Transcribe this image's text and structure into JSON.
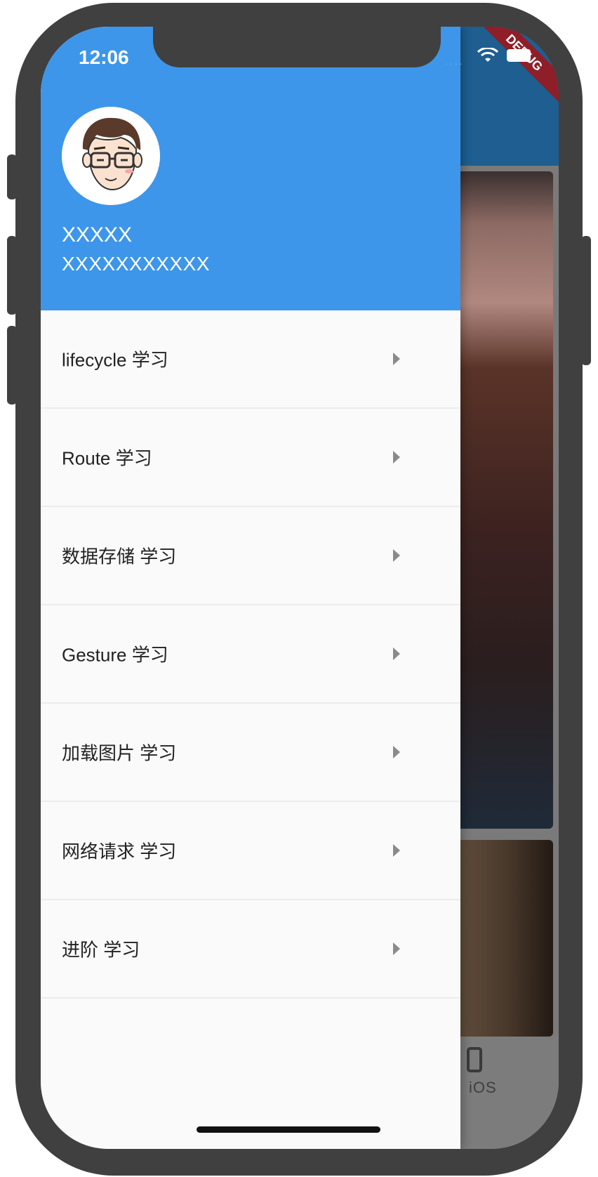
{
  "status_bar": {
    "time": "12:06"
  },
  "debug_banner": "DEBUG",
  "drawer": {
    "header": {
      "name": "XXXXX",
      "email": "XXXXXXXXXXX"
    },
    "menu_items": [
      {
        "label": "lifecycle 学习",
        "icon": "chevron-right-icon"
      },
      {
        "label": "Route 学习",
        "icon": "chevron-right-icon"
      },
      {
        "label": "数据存储 学习",
        "icon": "chevron-right-icon"
      },
      {
        "label": "Gesture 学习",
        "icon": "chevron-right-icon"
      },
      {
        "label": "加载图片 学习",
        "icon": "chevron-right-icon"
      },
      {
        "label": "网络请求 学习",
        "icon": "chevron-right-icon"
      },
      {
        "label": "进阶 学习",
        "icon": "chevron-right-icon"
      }
    ]
  },
  "background_app": {
    "bottom_tab_label": "iOS"
  },
  "colors": {
    "header": "#3d96ea",
    "drawer_bg": "#fafafa",
    "debug_ribbon": "#8e1f28",
    "frame": "#404040"
  }
}
